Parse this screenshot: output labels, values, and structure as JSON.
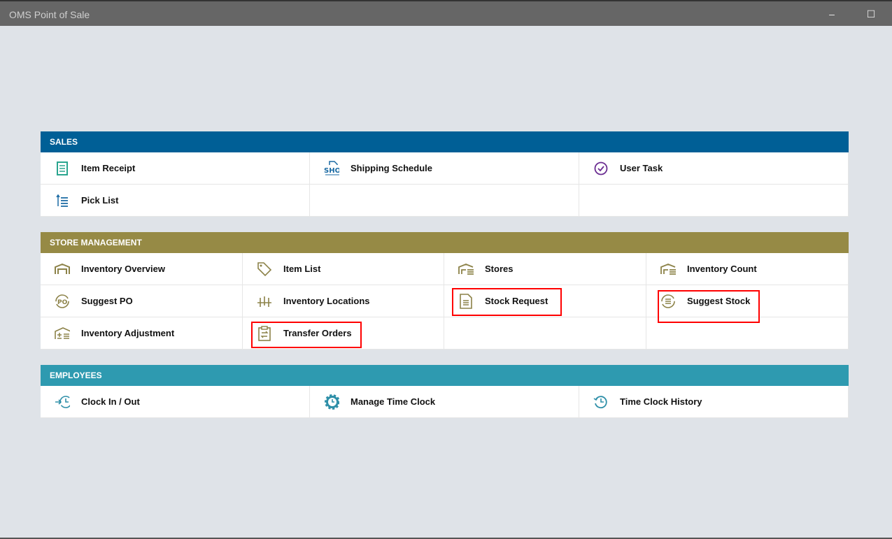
{
  "window": {
    "title": "OMS Point of Sale",
    "minimize": "–",
    "maximize": "☐"
  },
  "colors": {
    "sales": "#005f96",
    "store": "#968a45",
    "employees": "#2e9ab0"
  },
  "sections": [
    {
      "title": "SALES",
      "items": [
        {
          "label": "Item Receipt",
          "icon": "receipt-icon"
        },
        {
          "label": "Shipping Schedule",
          "icon": "shipping-schedule-icon"
        },
        {
          "label": "User Task",
          "icon": "check-circle-icon"
        },
        {
          "label": "Pick List",
          "icon": "pick-list-icon"
        }
      ]
    },
    {
      "title": "STORE MANAGEMENT",
      "items": [
        {
          "label": "Inventory Overview",
          "icon": "warehouse-icon"
        },
        {
          "label": "Item List",
          "icon": "tag-icon"
        },
        {
          "label": "Stores",
          "icon": "store-icon"
        },
        {
          "label": "Inventory Count",
          "icon": "inventory-count-icon"
        },
        {
          "label": "Suggest PO",
          "icon": "suggest-po-icon"
        },
        {
          "label": "Inventory Locations",
          "icon": "locations-icon"
        },
        {
          "label": "Stock Request",
          "icon": "document-icon"
        },
        {
          "label": "Suggest Stock",
          "icon": "suggest-stock-icon"
        },
        {
          "label": "Inventory Adjustment",
          "icon": "adjustment-icon"
        },
        {
          "label": "Transfer Orders",
          "icon": "clipboard-transfer-icon"
        }
      ]
    },
    {
      "title": "EMPLOYEES",
      "items": [
        {
          "label": "Clock In / Out",
          "icon": "clock-in-icon"
        },
        {
          "label": "Manage Time Clock",
          "icon": "gear-clock-icon"
        },
        {
          "label": "Time Clock History",
          "icon": "history-icon"
        }
      ]
    }
  ]
}
